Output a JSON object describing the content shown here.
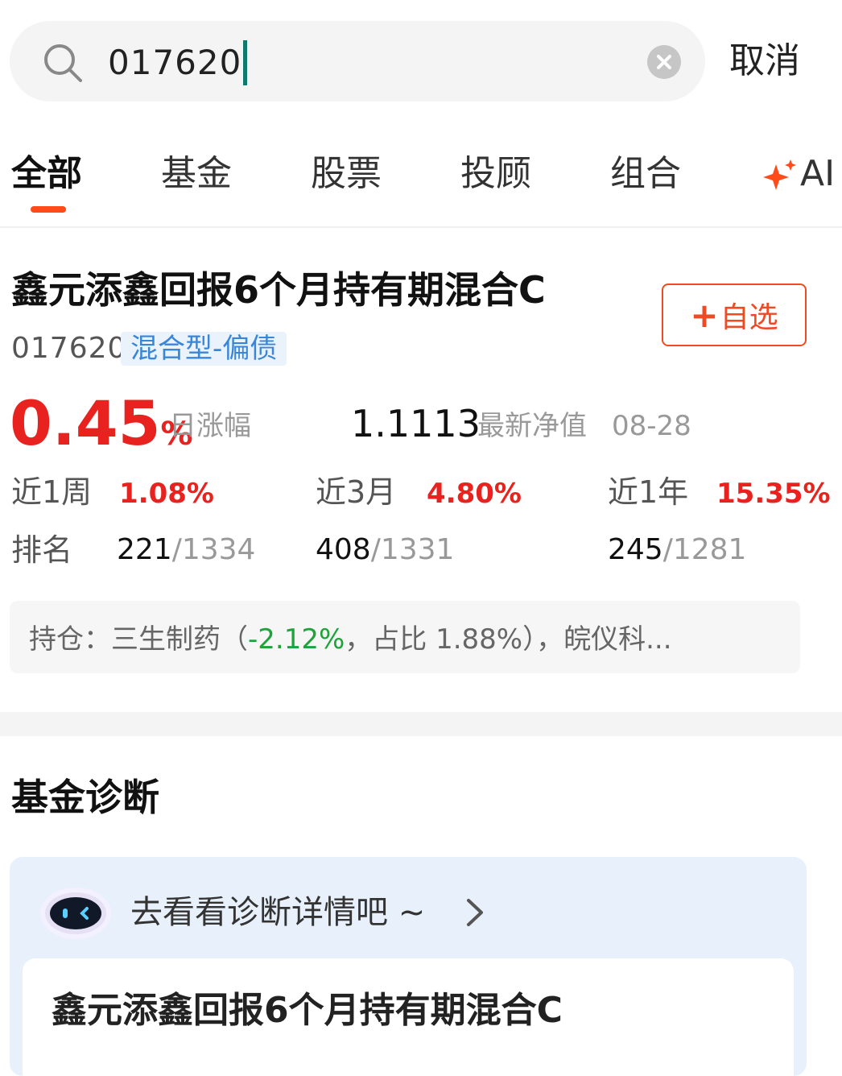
{
  "search": {
    "value": "017620",
    "cancel_label": "取消"
  },
  "tabs": [
    {
      "label": "全部"
    },
    {
      "label": "基金"
    },
    {
      "label": "股票"
    },
    {
      "label": "投顾"
    },
    {
      "label": "组合"
    },
    {
      "label": "AI"
    }
  ],
  "fund": {
    "name": "鑫元添鑫回报6个月持有期混合C",
    "watch_label": "自选",
    "code": "017620",
    "type": "混合型-偏债",
    "daily_change": "0.45",
    "daily_change_unit": "%",
    "daily_change_label": "日涨幅",
    "nav": "1.1113",
    "nav_label": "最新净值",
    "nav_date": "08-28",
    "performance": [
      {
        "label": "近1周",
        "value": "1.08%",
        "rank": "221",
        "total": "/1334"
      },
      {
        "label": "近3月",
        "value": "4.80%",
        "rank": "408",
        "total": "/1331"
      },
      {
        "label": "近1年",
        "value": "15.35%",
        "rank": "245",
        "total": "/1281"
      }
    ],
    "rank_label": "排名",
    "holding": {
      "prefix": "持仓：三生制药（",
      "change": "-2.12%",
      "suffix": "，占比 1.88%），皖仪科..."
    }
  },
  "diagnosis": {
    "section_title": "基金诊断",
    "link_label": "去看看诊断详情吧 ~",
    "fund_name": "鑫元添鑫回报6个月持有期混合C"
  },
  "colors": {
    "accent_red": "#e8231f",
    "tab_underline": "#ff4a1a",
    "type_tag_blue": "#3a86d6",
    "negative_green": "#1ea33b",
    "caret": "#0f7a6b"
  },
  "icons": {
    "search": "search-icon",
    "clear": "clear-icon",
    "ai_star": "sparkle-icon",
    "robot": "robot-avatar-icon",
    "chevron": "chevron-right-icon"
  }
}
